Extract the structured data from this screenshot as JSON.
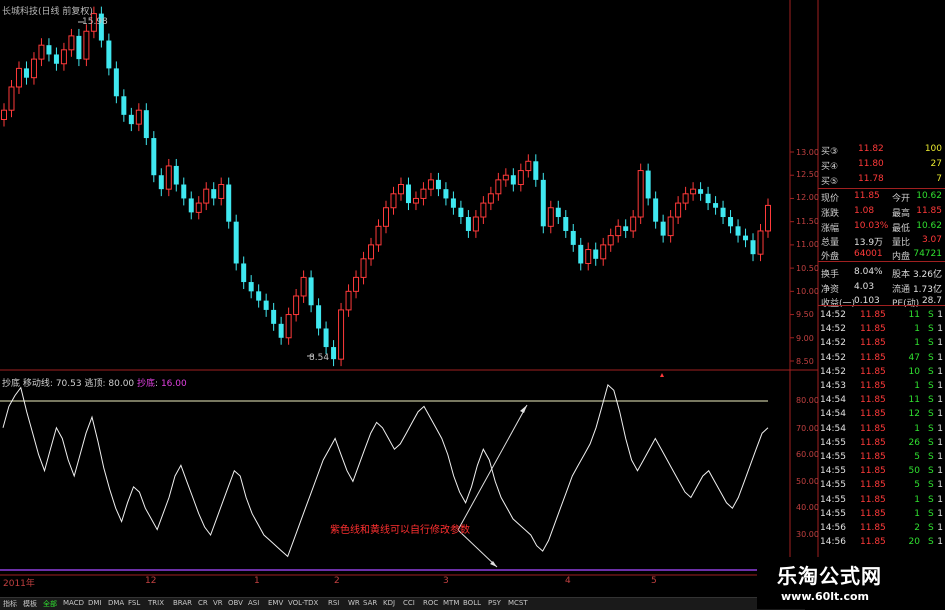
{
  "title": "长城科技(日线 前复权)",
  "price_high_label": "15.98",
  "price_low_label": "8.54",
  "price_axis": [
    "13.00",
    "12.50",
    "12.00",
    "11.50",
    "11.00",
    "10.50",
    "10.00",
    "9.50",
    "9.00",
    "8.50"
  ],
  "osc_axis": [
    "80.00",
    "70.00",
    "60.00",
    "50.00",
    "40.00",
    "30.00"
  ],
  "indicator": {
    "name": "抄底",
    "label": "移动线",
    "value": "70.53",
    "label2": "逃顶",
    "value2": "80.00",
    "mark": "抄底",
    "mark_value": "16.00"
  },
  "annotation": "紫色线和黄线可以自行修改参数",
  "x_labels": [
    "2011年",
    "12",
    "1",
    "2",
    "3",
    "4",
    "5"
  ],
  "quote": {
    "buy": [
      {
        "label": "买③",
        "price": "11.82",
        "vol": "100"
      },
      {
        "label": "买④",
        "price": "11.80",
        "vol": "27"
      },
      {
        "label": "买⑤",
        "price": "11.78",
        "vol": "7"
      }
    ],
    "rows": [
      {
        "l1": "现价",
        "v1": "11.85",
        "l2": "今开",
        "v2": "10.62"
      },
      {
        "l1": "涨跌",
        "v1": "1.08",
        "l2": "最高",
        "v2": "11.85"
      },
      {
        "l1": "涨幅",
        "v1": "10.03%",
        "l2": "最低",
        "v2": "10.62"
      },
      {
        "l1": "总量",
        "v1": "13.9万",
        "l2": "量比",
        "v2": "3.07"
      },
      {
        "l1": "外盘",
        "v1": "64001",
        "l2": "内盘",
        "v2": "74721"
      },
      {
        "l1": "换手",
        "v1": "8.04%",
        "l2": "股本",
        "v2": "3.26亿"
      },
      {
        "l1": "净资",
        "v1": "4.03",
        "l2": "流通",
        "v2": "1.73亿"
      },
      {
        "l1": "收益(一)",
        "v1": "0.103",
        "l2": "PE(动)",
        "v2": "28.7"
      }
    ],
    "ticks": [
      {
        "t": "14:52",
        "p": "11.85",
        "v": "11",
        "d": "S",
        "n": "1"
      },
      {
        "t": "14:52",
        "p": "11.85",
        "v": "1",
        "d": "S",
        "n": "1"
      },
      {
        "t": "14:52",
        "p": "11.85",
        "v": "1",
        "d": "S",
        "n": "1"
      },
      {
        "t": "14:52",
        "p": "11.85",
        "v": "47",
        "d": "S",
        "n": "1"
      },
      {
        "t": "14:52",
        "p": "11.85",
        "v": "10",
        "d": "S",
        "n": "1"
      },
      {
        "t": "14:53",
        "p": "11.85",
        "v": "1",
        "d": "S",
        "n": "1"
      },
      {
        "t": "14:54",
        "p": "11.85",
        "v": "11",
        "d": "S",
        "n": "1"
      },
      {
        "t": "14:54",
        "p": "11.85",
        "v": "12",
        "d": "S",
        "n": "1"
      },
      {
        "t": "14:54",
        "p": "11.85",
        "v": "1",
        "d": "S",
        "n": "1"
      },
      {
        "t": "14:55",
        "p": "11.85",
        "v": "26",
        "d": "S",
        "n": "1"
      },
      {
        "t": "14:55",
        "p": "11.85",
        "v": "5",
        "d": "S",
        "n": "1"
      },
      {
        "t": "14:55",
        "p": "11.85",
        "v": "50",
        "d": "S",
        "n": "1"
      },
      {
        "t": "14:55",
        "p": "11.85",
        "v": "5",
        "d": "S",
        "n": "1"
      },
      {
        "t": "14:55",
        "p": "11.85",
        "v": "1",
        "d": "S",
        "n": "1"
      },
      {
        "t": "14:55",
        "p": "11.85",
        "v": "1",
        "d": "S",
        "n": "1"
      },
      {
        "t": "14:56",
        "p": "11.85",
        "v": "2",
        "d": "S",
        "n": "1"
      },
      {
        "t": "14:56",
        "p": "11.85",
        "v": "20",
        "d": "S",
        "n": "1"
      }
    ]
  },
  "tabs": [
    "指标",
    "模板",
    "全部",
    "MACD",
    "DMI",
    "DMA",
    "FSL",
    "TRIX",
    "BRAR",
    "CR",
    "VR",
    "OBV",
    "ASI",
    "EMV",
    "VOL-TDX",
    "RSI",
    "WR",
    "SAR",
    "KDJ",
    "CCI",
    "ROC",
    "MTM",
    "BOLL",
    "PSY",
    "MCST"
  ],
  "active_tab": "全部",
  "logo": {
    "text": "乐淘公式网",
    "url": "www.60lt.com"
  },
  "colors": {
    "up": "#ff3a3a",
    "down": "#40e8f0",
    "osc_line": "#f0f0f0",
    "top_line": "#f0f0c0",
    "bottom_line": "#9040e0",
    "axis": "#a02020"
  }
}
